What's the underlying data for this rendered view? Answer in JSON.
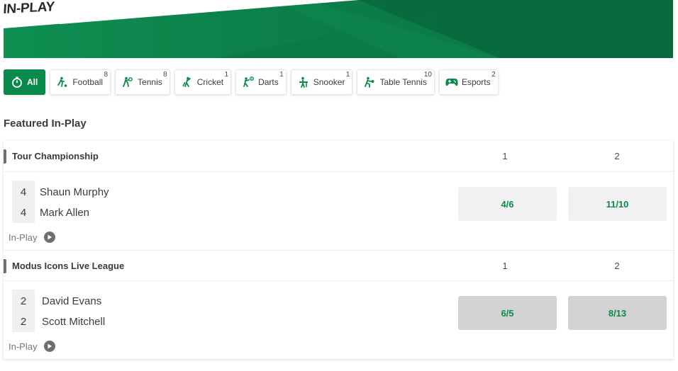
{
  "banner": {
    "title": "IN-PLAY"
  },
  "tabs": [
    {
      "label": "All",
      "count": "",
      "icon": "stopwatch-icon",
      "active": true
    },
    {
      "label": "Football",
      "count": "8",
      "icon": "football-icon"
    },
    {
      "label": "Tennis",
      "count": "8",
      "icon": "tennis-icon"
    },
    {
      "label": "Cricket",
      "count": "1",
      "icon": "cricket-icon"
    },
    {
      "label": "Darts",
      "count": "1",
      "icon": "darts-icon"
    },
    {
      "label": "Snooker",
      "count": "1",
      "icon": "snooker-icon"
    },
    {
      "label": "Table Tennis",
      "count": "10",
      "icon": "table-tennis-icon"
    },
    {
      "label": "Esports",
      "count": "2",
      "icon": "gamepad-icon"
    }
  ],
  "section_title": "Featured In-Play",
  "events": [
    {
      "competition": "Tour Championship",
      "col1": "1",
      "col2": "2",
      "players": [
        {
          "score": "4",
          "name": "Shaun Murphy"
        },
        {
          "score": "4",
          "name": "Mark Allen"
        }
      ],
      "status": "In-Play",
      "odds": [
        "4/6",
        "11/10"
      ],
      "suspended": false
    },
    {
      "competition": "Modus Icons Live League",
      "col1": "1",
      "col2": "2",
      "players": [
        {
          "score": "2",
          "name": "David Evans"
        },
        {
          "score": "2",
          "name": "Scott Mitchell"
        }
      ],
      "status": "In-Play",
      "odds": [
        "6/5",
        "8/13"
      ],
      "suspended": true
    }
  ],
  "colors": {
    "brand_green": "#0a8a4a",
    "odds_bg": "#f1f1f3",
    "odds_dim_bg": "#d3d3d6"
  }
}
